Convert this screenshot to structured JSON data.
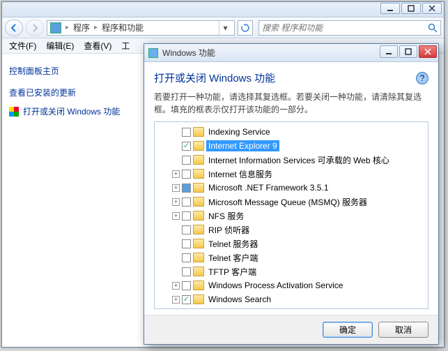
{
  "main": {
    "caption_buttons": {
      "min": "minimize",
      "max": "maximize",
      "close": "close"
    },
    "breadcrumb": {
      "seg1": "程序",
      "seg2": "程序和功能"
    },
    "search_placeholder": "搜索 程序和功能",
    "menubar": {
      "file": "文件(F)",
      "edit": "编辑(E)",
      "view": "查看(V)",
      "tools": "工"
    }
  },
  "sidebar": {
    "home": "控制面板主页",
    "updates": "查看已安装的更新",
    "features": "打开或关闭 Windows 功能"
  },
  "dialog": {
    "title": "Windows 功能",
    "heading": "打开或关闭 Windows 功能",
    "desc": "若要打开一种功能，请选择其复选框。若要关闭一种功能，请清除其复选框。填充的框表示仅打开该功能的一部分。",
    "ok": "确定",
    "cancel": "取消",
    "tree": [
      {
        "expander": "none",
        "checked": "",
        "label": "Indexing Service"
      },
      {
        "expander": "none",
        "checked": "checked",
        "label": "Internet Explorer 9",
        "selected": true
      },
      {
        "expander": "none",
        "checked": "",
        "label": "Internet Information Services 可承载的 Web 核心"
      },
      {
        "expander": "plus",
        "checked": "",
        "label": "Internet 信息服务"
      },
      {
        "expander": "plus",
        "checked": "partial",
        "label": "Microsoft .NET Framework 3.5.1"
      },
      {
        "expander": "plus",
        "checked": "",
        "label": "Microsoft Message Queue (MSMQ) 服务器"
      },
      {
        "expander": "plus",
        "checked": "",
        "label": "NFS 服务"
      },
      {
        "expander": "none",
        "checked": "",
        "label": "RIP 侦听器"
      },
      {
        "expander": "none",
        "checked": "",
        "label": "Telnet 服务器"
      },
      {
        "expander": "none",
        "checked": "",
        "label": "Telnet 客户端"
      },
      {
        "expander": "none",
        "checked": "",
        "label": "TFTP 客户端"
      },
      {
        "expander": "plus",
        "checked": "",
        "label": "Windows Process Activation Service"
      },
      {
        "expander": "plus",
        "checked": "checked",
        "label": "Windows Search"
      }
    ]
  }
}
